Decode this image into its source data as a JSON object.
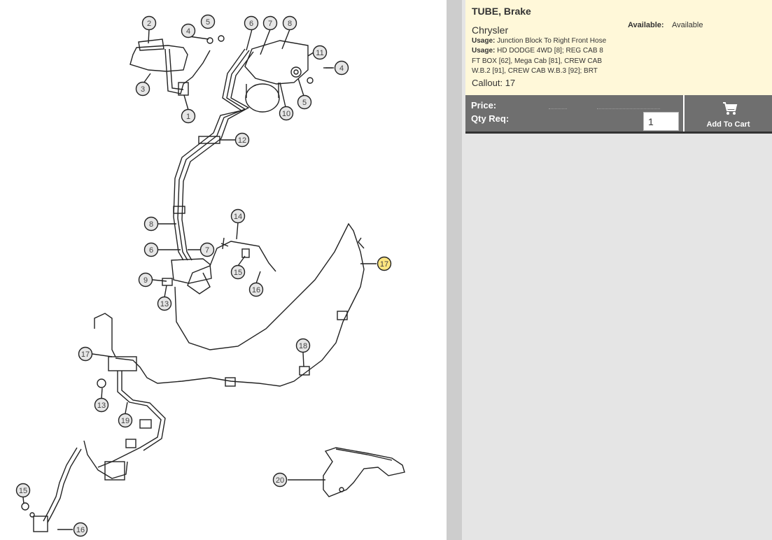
{
  "diagram": {
    "callouts": [
      {
        "label": "2"
      },
      {
        "label": "4"
      },
      {
        "label": "5"
      },
      {
        "label": "3"
      },
      {
        "label": "1"
      },
      {
        "label": "6"
      },
      {
        "label": "7"
      },
      {
        "label": "8"
      },
      {
        "label": "11"
      },
      {
        "label": "4"
      },
      {
        "label": "5"
      },
      {
        "label": "10"
      },
      {
        "label": "12"
      },
      {
        "label": "8"
      },
      {
        "label": "6"
      },
      {
        "label": "7"
      },
      {
        "label": "14"
      },
      {
        "label": "15"
      },
      {
        "label": "16"
      },
      {
        "label": "9"
      },
      {
        "label": "13"
      },
      {
        "label": "17"
      },
      {
        "label": "17"
      },
      {
        "label": "18"
      },
      {
        "label": "13"
      },
      {
        "label": "19"
      },
      {
        "label": "15"
      },
      {
        "label": "16"
      },
      {
        "label": "20"
      }
    ],
    "highlight_color": "#ffe680"
  },
  "part": {
    "title": "TUBE, Brake",
    "brand": "Chrysler",
    "usage1_label": "Usage:",
    "usage1_text": "Junction Block To Right Front Hose",
    "usage2_label": "Usage:",
    "usage2_text": "HD DODGE 4WD [8]; REG CAB 8 FT BOX [62], Mega Cab [81], CREW CAB W.B.2 [91], CREW CAB W.B.3 [92]; BRT",
    "callout": "Callout: 17",
    "availability_label": "Available:",
    "availability_value": "Available"
  },
  "purchase": {
    "price_label": "Price:",
    "qty_label": "Qty Req:",
    "qty_value": "1",
    "cart_label": "Add To Cart",
    "cart_icon": "shopping-cart-icon"
  },
  "colors": {
    "info_bg": "#fff8d9",
    "bar_bg": "#6f6f6f",
    "panel_bg": "#e5e5e5",
    "divider": "#cdcdcd"
  }
}
